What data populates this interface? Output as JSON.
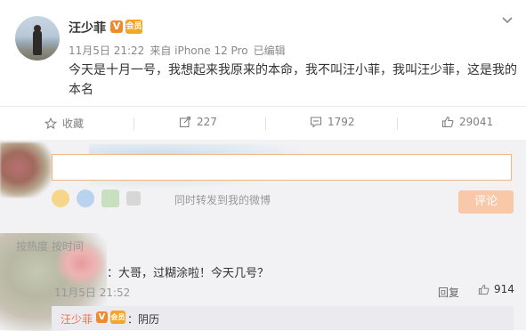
{
  "post": {
    "username": "汪少菲",
    "verified_badge": "V",
    "vip_badge": "会员",
    "time": "11月5日 21:22",
    "source": "来自 iPhone 12 Pro",
    "edited": "已编辑",
    "text": "今天是十月一号，我想起来我原来的本命，我不叫汪小菲，我叫汪少菲，这是我的本名",
    "menu_icon": "chevron-down-icon"
  },
  "actions": {
    "favorite_label": "收藏",
    "repost_count": "227",
    "comment_count": "1792",
    "like_count": "29041"
  },
  "compose": {
    "input_value": "",
    "forward_label": "同时转发到我的微博",
    "submit_label": "评论"
  },
  "comments": {
    "sort_label": "按热度  按时间",
    "items": [
      {
        "text": "：大哥，过糊涂啦！今天几号？",
        "time": "11月5日 21:52",
        "reply_label": "回复",
        "like_count": "914"
      }
    ],
    "sub_reply": {
      "name": "汪少菲",
      "v": "V",
      "vip": "会员",
      "text": "：阴历"
    }
  },
  "colors": {
    "accent": "#eb7350",
    "verified": "#f08a2a",
    "button": "#f8c8a8"
  }
}
